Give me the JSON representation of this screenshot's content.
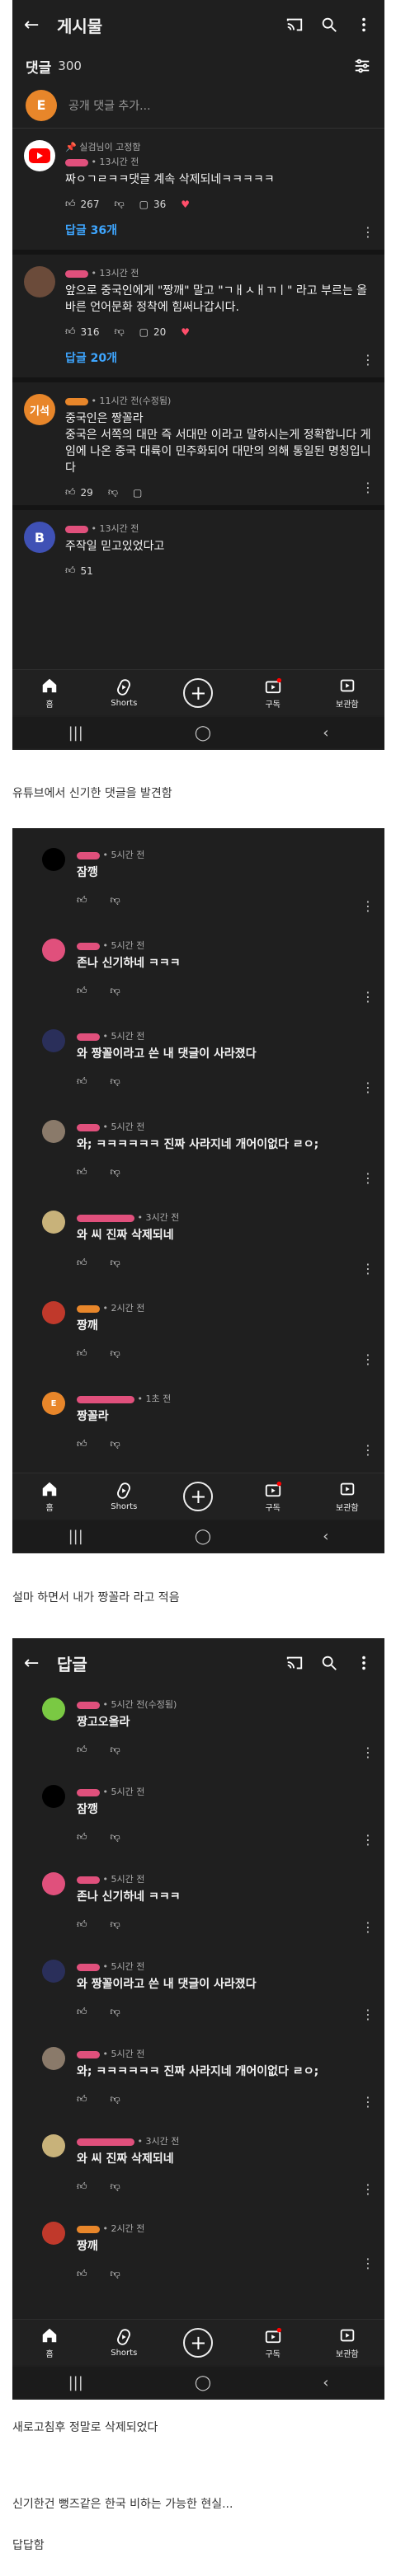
{
  "shot1": {
    "header_title": "게시물",
    "count_label": "댓글",
    "count_value": "300",
    "add_placeholder": "공개 댓글 추가...",
    "my_avatar_letter": "E",
    "comments": [
      {
        "pin": "📌 실검님이 고정함",
        "time": "• 13시간 전",
        "text": "짜ㅇㄱㄹㅋㅋ댓글 계속 삭제되네ㅋㅋㅋㅋㅋ",
        "likes": "267",
        "replies_count": "36",
        "replies_link": "답글 36개"
      },
      {
        "time": "• 13시간 전",
        "text": "앞으로 중국인에게 \"짱깨\" 말고 \"ㄱㅐㅅㅐㄲㅣ\" 라고 부르는 올바른 언어문화 정착에 힘써나갑시다.",
        "likes": "316",
        "replies_count": "20",
        "replies_link": "답글 20개"
      },
      {
        "avatar": "기석",
        "time": "• 11시간 전(수정됨)",
        "text": "중국인은 짱꼴라\n중국은 서쪽의 대만   즉 서대만 이라고 말하시는게 정확합니다 게임에 나온 중국 대륙이 민주화되어 대만의 의해 통일된 명칭입니다",
        "likes": "29"
      },
      {
        "avatar": "B",
        "time": "• 13시간 전",
        "text": "주작일 믿고있었다고",
        "likes": "51"
      }
    ]
  },
  "caption1": "유튜브에서 신기한 댓글을 발견함",
  "shot2": {
    "comments": [
      {
        "time": "• 5시간 전",
        "text": "잠깽"
      },
      {
        "time": "• 5시간 전",
        "text": "존나 신기하네 ㅋㅋㅋ"
      },
      {
        "time": "• 5시간 전",
        "text": "와 짱꼴이라고 쓴 내 댓글이 사라졌다"
      },
      {
        "time": "• 5시간 전",
        "text": "와; ㅋㅋㅋㅋㅋㅋ 진짜 사라지네 개어이없다 ㄹㅇ;"
      },
      {
        "time": "• 3시간 전",
        "text": "와 씨 진짜 삭제되네"
      },
      {
        "time": "• 2시간 전",
        "text": "짱깨"
      },
      {
        "time": "• 1초 전",
        "text": "짱꼴라"
      }
    ]
  },
  "caption2": "설마 하면서 내가 짱꼴라 라고 적음",
  "shot3": {
    "header_title": "답글",
    "comments": [
      {
        "time": "• 5시간 전(수정됨)",
        "text": "짱고오올라"
      },
      {
        "time": "• 5시간 전",
        "text": "잠깽"
      },
      {
        "time": "• 5시간 전",
        "text": "존나 신기하네 ㅋㅋㅋ"
      },
      {
        "time": "• 5시간 전",
        "text": "와 짱꼴이라고 쓴 내 댓글이 사라졌다"
      },
      {
        "time": "• 5시간 전",
        "text": "와; ㅋㅋㅋㅋㅋㅋ 진짜 사라지네 개어이없다 ㄹㅇ;"
      },
      {
        "time": "• 3시간 전",
        "text": "와 씨 진짜 삭제되네"
      },
      {
        "time": "• 2시간 전",
        "text": "짱깨"
      }
    ]
  },
  "caption3": "새로고침후 정말로 삭제되었다",
  "caption4": "신기한건 뻥즈같은 한국 비하는 가능한 현실...",
  "caption5": "답답함",
  "nav": {
    "home": "홈",
    "shorts": "Shorts",
    "subs": "구독",
    "library": "보관함"
  },
  "colors": {
    "bg": "#1f1f1f",
    "link": "#3ea6ff",
    "orange": "#e8862a"
  }
}
